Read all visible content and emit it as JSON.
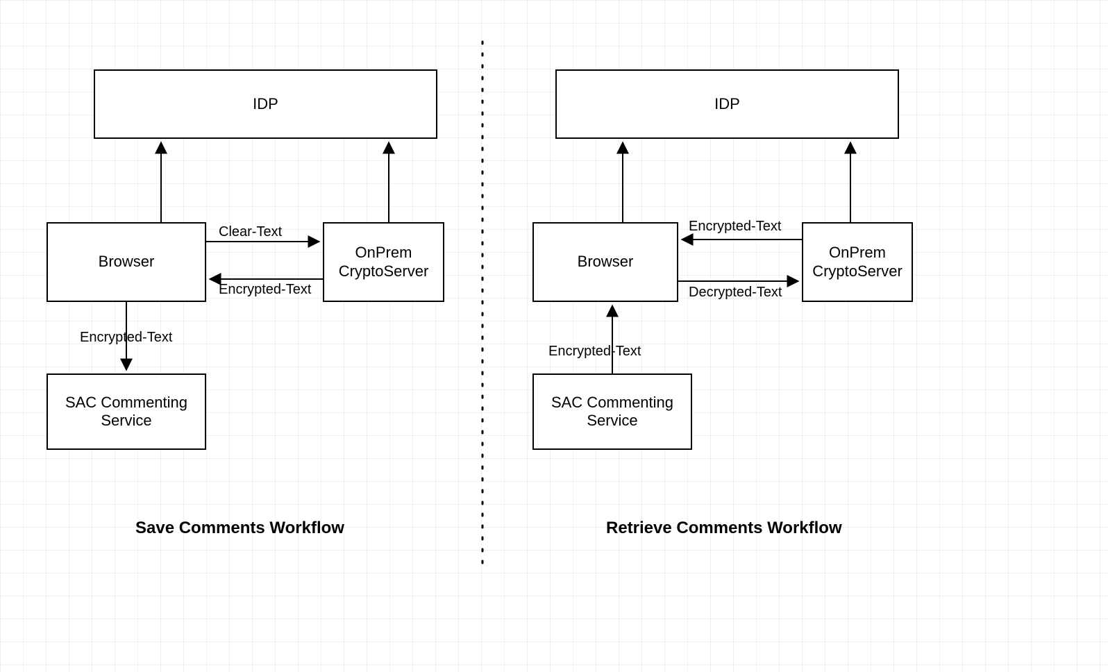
{
  "left": {
    "title": "Save Comments Workflow",
    "idp": "IDP",
    "browser": "Browser",
    "crypto": "OnPrem CryptoServer",
    "sac": "SAC Commenting Service",
    "edge_browser_to_crypto": "Clear-Text",
    "edge_crypto_to_browser": "Encrypted-Text",
    "edge_browser_to_sac": "Encrypted-Text"
  },
  "right": {
    "title": "Retrieve Comments Workflow",
    "idp": "IDP",
    "browser": "Browser",
    "crypto": "OnPrem CryptoServer",
    "sac": "SAC Commenting Service",
    "edge_crypto_to_browser": "Encrypted-Text",
    "edge_browser_to_crypto": "Decrypted-Text",
    "edge_sac_to_browser": "Encrypted-Text"
  }
}
